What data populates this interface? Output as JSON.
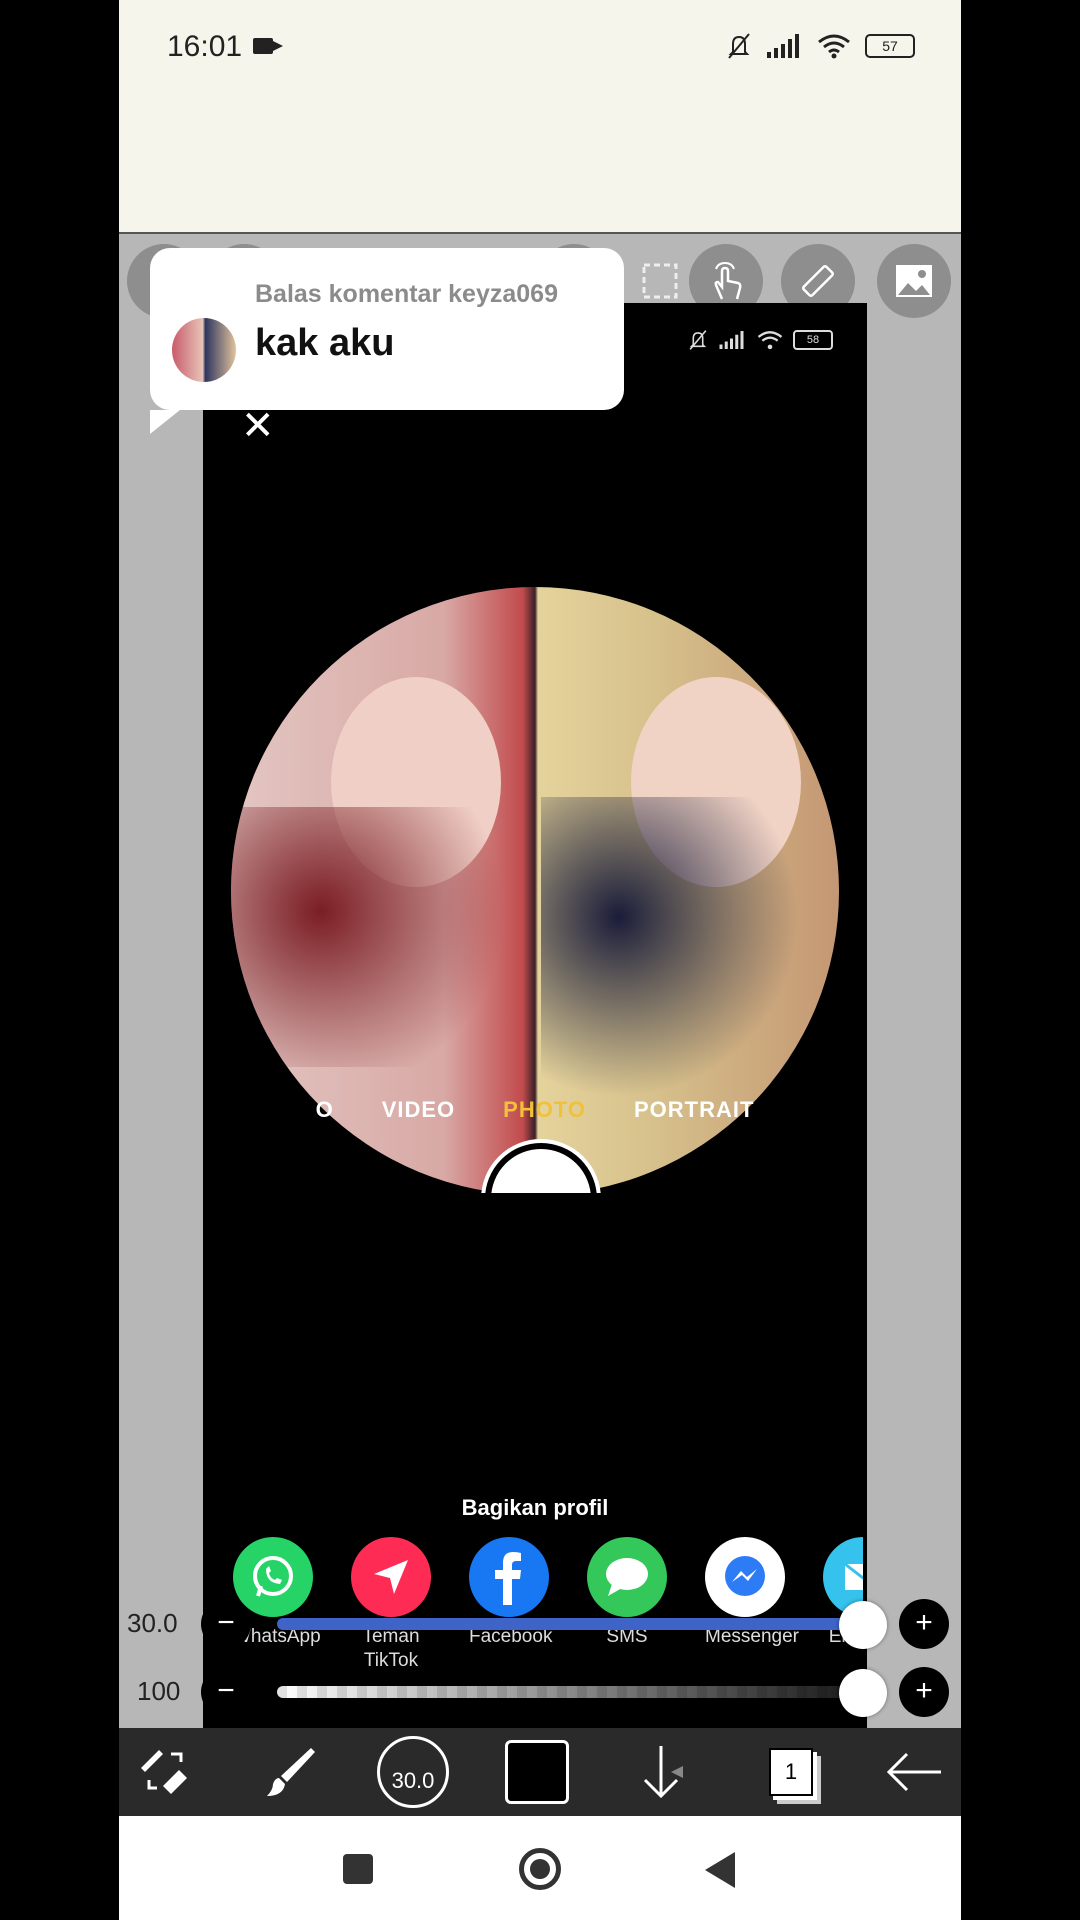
{
  "status": {
    "time": "16:01",
    "battery": "57"
  },
  "inner_status": {
    "battery": "58"
  },
  "comment": {
    "header": "Balas komentar keyza069",
    "text": "kak aku"
  },
  "camera_modes": [
    "O",
    "VIDEO",
    "PHOTO",
    "PORTRAIT"
  ],
  "active_mode": "PHOTO",
  "share": {
    "title": "Bagikan profil",
    "items": [
      {
        "label": "WhatsApp",
        "color": "#25d366",
        "icon": "whatsapp-icon"
      },
      {
        "label": "Teman TikTok",
        "color": "#fe2c55",
        "icon": "send-icon"
      },
      {
        "label": "Facebook",
        "color": "#1877f2",
        "icon": "facebook-icon"
      },
      {
        "label": "SMS",
        "color": "#34c759",
        "icon": "sms-icon"
      },
      {
        "label": "Messenger",
        "color": "#ffffff",
        "icon": "messenger-icon"
      },
      {
        "label": "Em",
        "color": "#35c2ec",
        "icon": "email-icon"
      }
    ]
  },
  "sliders": {
    "size": {
      "value": "30.0",
      "fill_fraction": 0.99,
      "color": "#3e64c8"
    },
    "opacity": {
      "value": "100",
      "fill_fraction": 1.0
    }
  },
  "toolbar": {
    "brush_size": "30.0",
    "layer_count": "1",
    "current_color": "#000000"
  }
}
